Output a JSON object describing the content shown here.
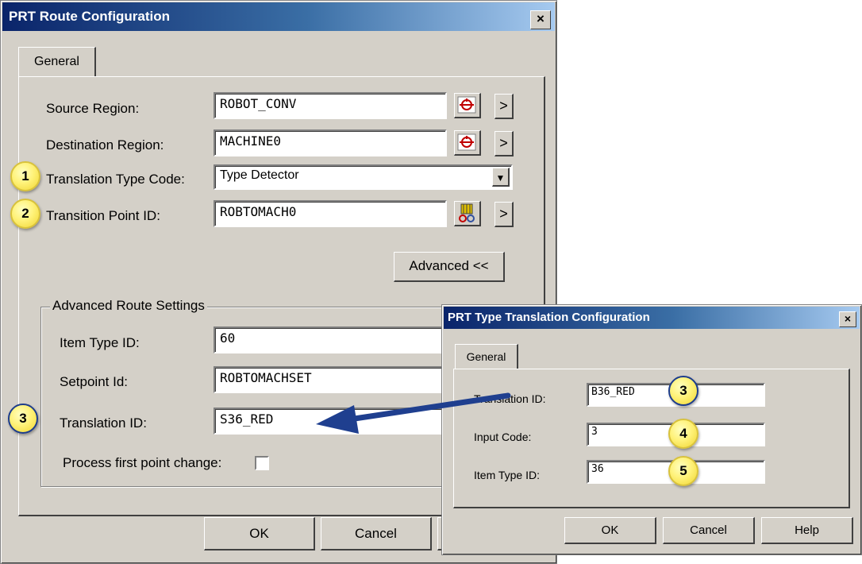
{
  "route_dialog": {
    "title": "PRT Route Configuration",
    "close": "×",
    "tab": "General",
    "source_region_label": "Source Region:",
    "source_region_value": "ROBOT_CONV",
    "destination_region_label": "Destination Region:",
    "destination_region_value": "MACHINE0",
    "translation_type_label": "Translation Type Code:",
    "translation_type_value": "Type Detector",
    "transition_point_label": "Transition Point ID:",
    "transition_point_value": "ROBTOMACH0",
    "advanced_button": "Advanced <<",
    "advanced_group_title": "Advanced Route Settings",
    "item_type_label": "Item Type ID:",
    "item_type_value": "60",
    "setpoint_label": "Setpoint Id:",
    "setpoint_value": "ROBTOMACHSET",
    "translation_id_label": "Translation ID:",
    "translation_id_value": "S36_RED",
    "process_first_label": "Process first point change:",
    "ok_button": "OK",
    "cancel_button": "Cancel",
    "arrow_glyph": ">"
  },
  "type_dialog": {
    "title": "PRT Type Translation Configuration",
    "close": "×",
    "tab": "General",
    "translation_id_label": "Translation ID:",
    "translation_id_value": "B36_RED",
    "input_code_label": "Input Code:",
    "input_code_value": "3",
    "item_type_label": "Item Type ID:",
    "item_type_value": "36",
    "ok_button": "OK",
    "cancel_button": "Cancel",
    "help_button": "Help"
  },
  "callouts": {
    "badge_1": "1",
    "badge_2": "2",
    "badge_3_left": "3",
    "badge_3_right": "3",
    "badge_4": "4",
    "badge_5": "5"
  },
  "colors": {
    "dialog_bg": "#d4d0c8",
    "title_gradient_start": "#0a246a",
    "callout_yellow": "#fff27a",
    "arrow_blue": "#1f3f8f"
  },
  "icons": {
    "region_picker": "region-picker-icon",
    "transition_point_picker": "transition-point-picker-icon",
    "dropdown": "chevron-down-icon"
  }
}
